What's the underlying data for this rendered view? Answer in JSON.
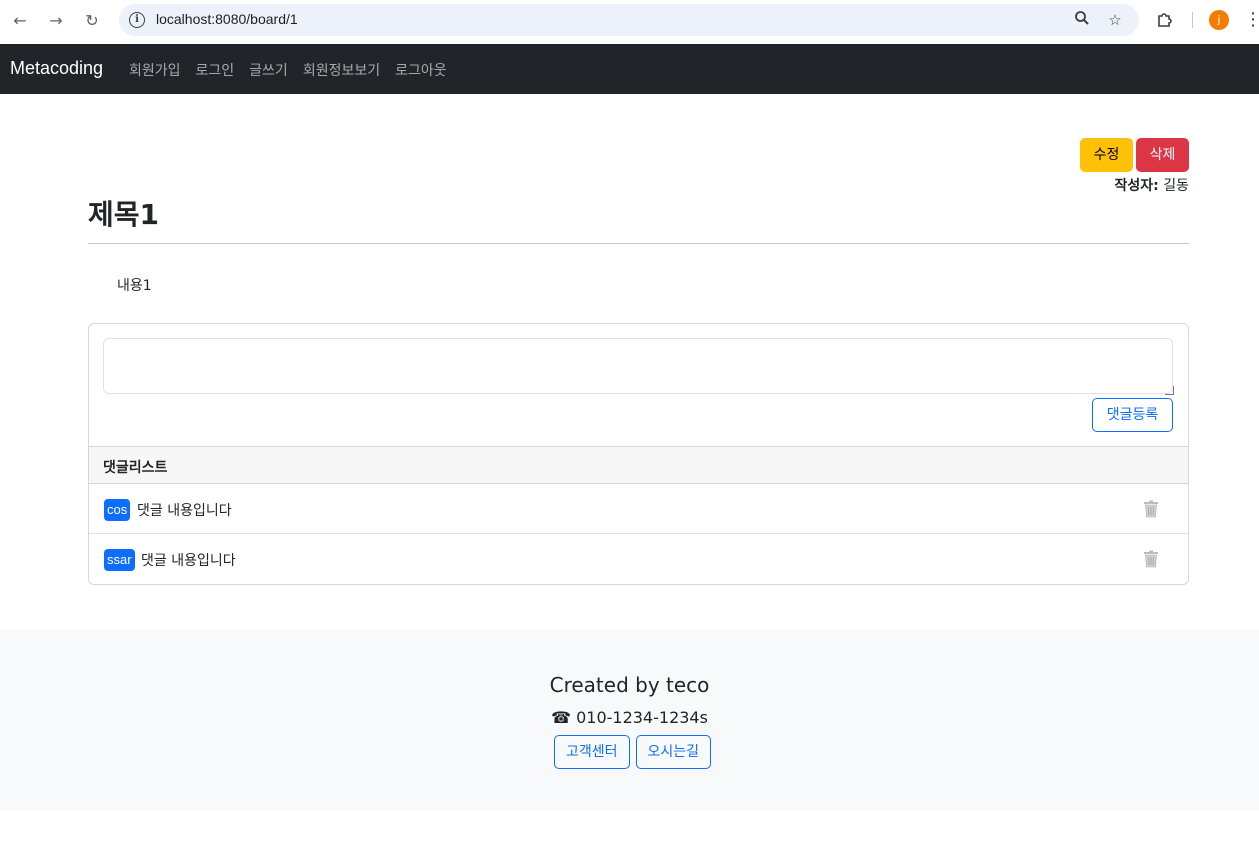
{
  "browser": {
    "url": "localhost:8080/board/1",
    "profile_initial": "j",
    "icons": [
      "back-icon",
      "forward-icon",
      "reload-icon",
      "info-icon",
      "zoom-icon",
      "star-icon",
      "extensions-icon",
      "more-icon"
    ]
  },
  "navbar": {
    "brand": "Metacoding",
    "links": [
      "회원가입",
      "로그인",
      "글쓰기",
      "회원정보보기",
      "로그아웃"
    ]
  },
  "post": {
    "edit_label": "수정",
    "delete_label": "삭제",
    "author_label": "작성자:",
    "author_name": "길동",
    "title": "제목1",
    "content": "내용1"
  },
  "reply": {
    "textarea_value": "",
    "submit_label": "댓글등록",
    "list_header": "댓글리스트",
    "items": [
      {
        "user": "cos",
        "text": "댓글 내용입니다"
      },
      {
        "user": "ssar",
        "text": "댓글 내용입니다"
      }
    ]
  },
  "footer": {
    "title": "Created by teco",
    "phone": "☎ 010-1234-1234s",
    "buttons": [
      "고객센터",
      "오시는길"
    ]
  },
  "colors": {
    "navbar": "#212529",
    "primary": "#0d6efd",
    "warning": "#ffc107",
    "danger": "#dc3545"
  }
}
